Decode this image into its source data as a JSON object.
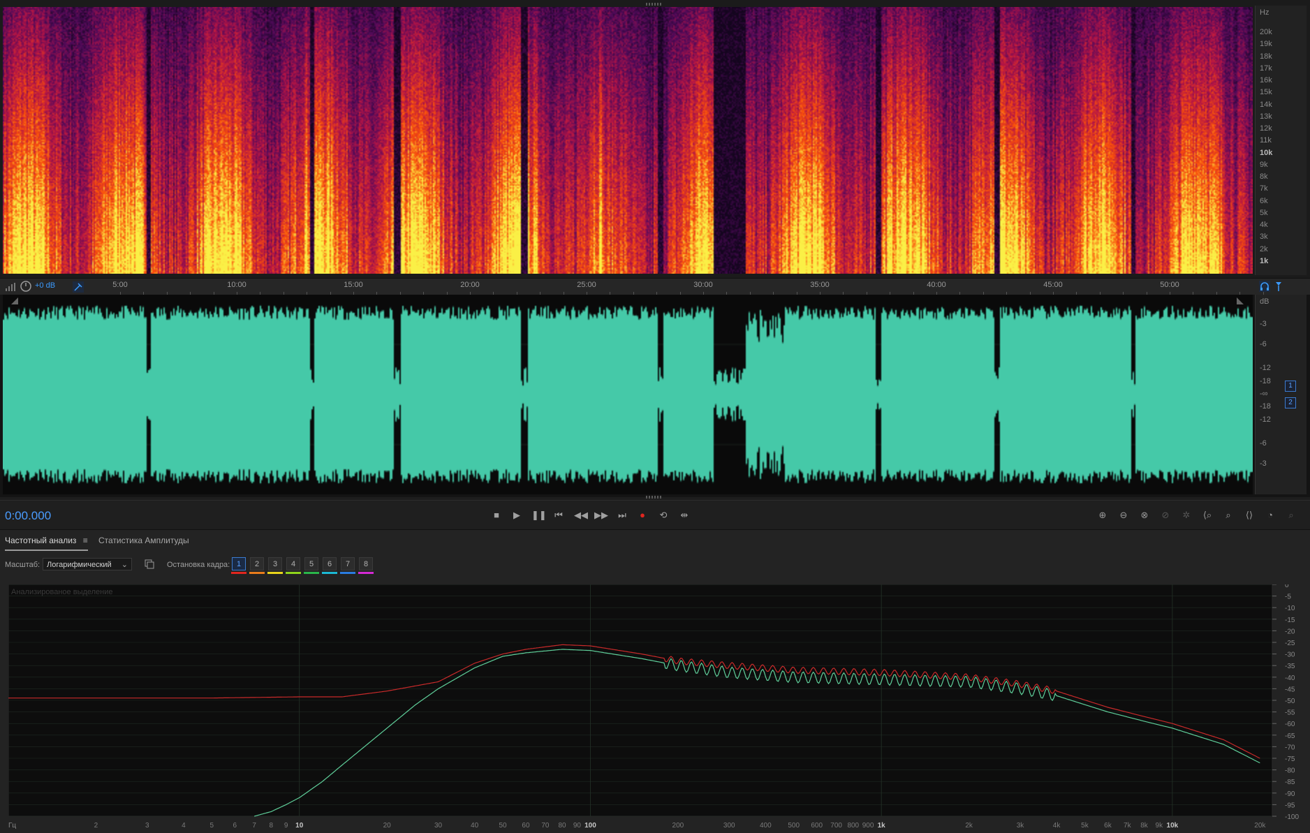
{
  "spectral": {
    "hz_unit": "Hz",
    "hz_labels": [
      {
        "text": "20k",
        "bold": false
      },
      {
        "text": "19k",
        "bold": false
      },
      {
        "text": "18k",
        "bold": false
      },
      {
        "text": "17k",
        "bold": false
      },
      {
        "text": "16k",
        "bold": false
      },
      {
        "text": "15k",
        "bold": false
      },
      {
        "text": "14k",
        "bold": false
      },
      {
        "text": "13k",
        "bold": false
      },
      {
        "text": "12k",
        "bold": false
      },
      {
        "text": "11k",
        "bold": false
      },
      {
        "text": "10k",
        "bold": true
      },
      {
        "text": "9k",
        "bold": false
      },
      {
        "text": "8k",
        "bold": false
      },
      {
        "text": "7k",
        "bold": false
      },
      {
        "text": "6k",
        "bold": false
      },
      {
        "text": "5k",
        "bold": false
      },
      {
        "text": "4k",
        "bold": false
      },
      {
        "text": "3k",
        "bold": false
      },
      {
        "text": "2k",
        "bold": false
      },
      {
        "text": "1k",
        "bold": true
      }
    ]
  },
  "timeline": {
    "gain": "+0 dB",
    "ticks": [
      "5:00",
      "10:00",
      "15:00",
      "20:00",
      "25:00",
      "30:00",
      "35:00",
      "40:00",
      "45:00",
      "50:00"
    ]
  },
  "waveform": {
    "db_unit": "dB",
    "db_labels": [
      "-3",
      "-6",
      "-12",
      "-18",
      "-∞",
      "-18",
      "-12",
      "-6",
      "-3"
    ],
    "channels": [
      "1",
      "2"
    ],
    "fill_color": "#45c9a8"
  },
  "transport": {
    "time": "0:00.000"
  },
  "panel": {
    "tabs": [
      "Частотный анализ",
      "Статистика Амплитуды"
    ],
    "scale_label": "Масштаб:",
    "scale_value": "Логарифмический",
    "freeze_label": "Остановка кадра:",
    "frames": [
      {
        "n": "1",
        "color": "#e0261f"
      },
      {
        "n": "2",
        "color": "#e87b1b"
      },
      {
        "n": "3",
        "color": "#e8d41b"
      },
      {
        "n": "4",
        "color": "#8fd41b"
      },
      {
        "n": "5",
        "color": "#2ab54a"
      },
      {
        "n": "6",
        "color": "#1bb8d4"
      },
      {
        "n": "7",
        "color": "#2a7be0"
      },
      {
        "n": "8",
        "color": "#d42ad4"
      }
    ]
  },
  "chart_data": {
    "type": "line",
    "title": "Анализированое выделение",
    "x_scale": "log",
    "x_unit": "Гц",
    "y_unit": "дБ",
    "xlim": [
      1,
      22050
    ],
    "ylim": [
      -100,
      0
    ],
    "x_tick_labels": [
      "2",
      "3",
      "4",
      "5",
      "6",
      "7",
      "8",
      "9",
      "10",
      "20",
      "30",
      "40",
      "50",
      "60",
      "70",
      "80",
      "90",
      "100",
      "200",
      "300",
      "400",
      "500",
      "600",
      "700",
      "800",
      "900",
      "1k",
      "2k",
      "3k",
      "4k",
      "5k",
      "6k",
      "7k",
      "8k",
      "9k",
      "10k",
      "20k"
    ],
    "y_tick_labels": [
      "0",
      "-5",
      "-10",
      "-15",
      "-20",
      "-25",
      "-30",
      "-35",
      "-40",
      "-45",
      "-50",
      "-55",
      "-60",
      "-65",
      "-70",
      "-75",
      "-80",
      "-85",
      "-90",
      "-95",
      "-100"
    ],
    "series": [
      {
        "color": "#c82a2a",
        "x": [
          1,
          5,
          10,
          14,
          20,
          30,
          40,
          50,
          60,
          80,
          100,
          150,
          200,
          300,
          500,
          1000,
          2000,
          3000,
          4000,
          6000,
          8000,
          10000,
          15000,
          20000
        ],
        "y": [
          -49,
          -49,
          -48.5,
          -48.5,
          -46,
          -42,
          -34,
          -30,
          -28,
          -26,
          -26.5,
          -30,
          -33,
          -35,
          -37,
          -38,
          -40,
          -43,
          -46,
          -53,
          -57,
          -60,
          -67,
          -75
        ]
      },
      {
        "color": "#5fcf9a",
        "x": [
          7,
          8,
          9,
          10,
          12,
          14,
          16,
          20,
          25,
          30,
          40,
          50,
          60,
          80,
          100,
          150,
          200,
          300,
          500,
          1000,
          2000,
          3000,
          4000,
          6000,
          8000,
          10000,
          15000,
          20000
        ],
        "y": [
          -100,
          -98,
          -95,
          -92,
          -85,
          -78,
          -72,
          -62,
          -52,
          -45,
          -36,
          -31,
          -29.5,
          -28,
          -28.5,
          -32,
          -35,
          -38,
          -40,
          -41,
          -42,
          -45,
          -48,
          -55,
          -59,
          -62,
          -69,
          -77
        ]
      }
    ]
  }
}
